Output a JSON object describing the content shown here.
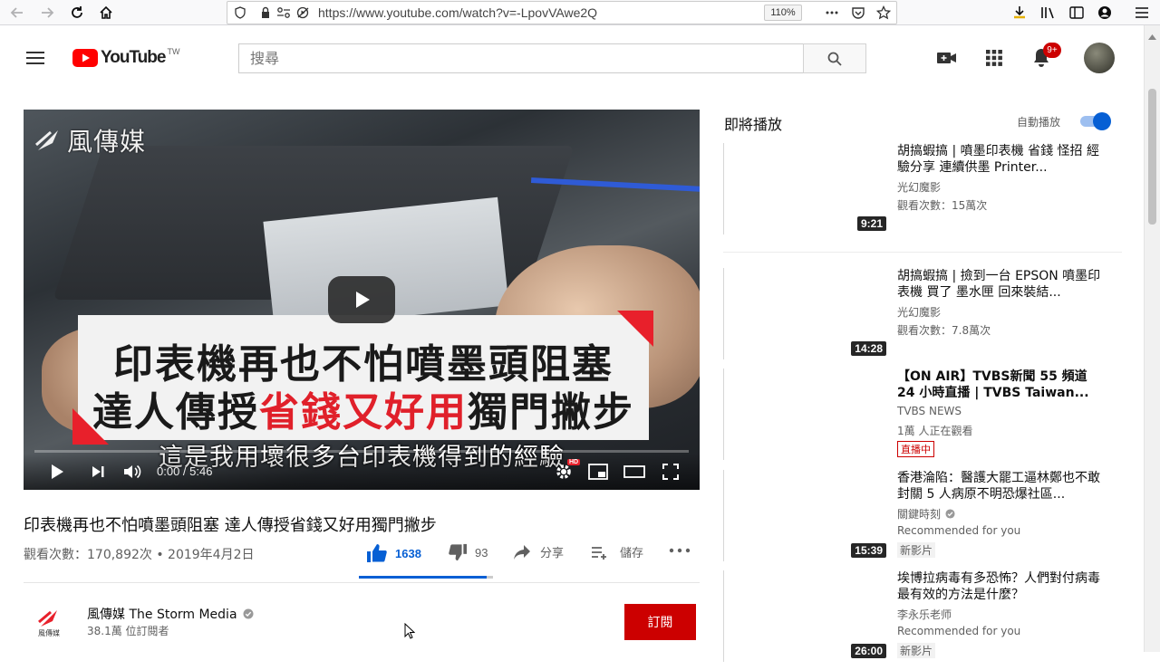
{
  "browser": {
    "url": "https://www.youtube.com/watch?v=-LpovVAwe2Q",
    "zoom": "110%"
  },
  "header": {
    "logo_text": "YouTube",
    "logo_region": "TW",
    "search_placeholder": "搜尋",
    "notification_count": "9+"
  },
  "player": {
    "watermark": "風傳媒",
    "banner_line1": "印表機再也不怕噴墨頭阻塞",
    "banner_line2_a": "達人傳授",
    "banner_line2_b": "省錢又好用",
    "banner_line2_c": "獨門撇步",
    "subtitle": "這是我用壞很多台印表機得到的經驗",
    "time": "0:00 / 5:46",
    "hd_badge": "HD"
  },
  "video": {
    "title": "印表機再也不怕噴墨頭阻塞 達人傳授省錢又好用獨門撇步",
    "views_date": "觀看次數：170,892次 • 2019年4月2日",
    "likes": "1638",
    "dislikes": "93",
    "share_label": "分享",
    "save_label": "儲存",
    "like_ratio": 0.95
  },
  "channel": {
    "logo_text": "風傳媒",
    "name": "風傳媒 The Storm Media",
    "subscribers": "38.1萬 位訂閱者",
    "subscribe_label": "訂閱"
  },
  "sidebar": {
    "up_next": "即將播放",
    "autoplay_label": "自動播放",
    "items": [
      {
        "title": "胡搞蝦搞 | 噴墨印表機 省錢 怪招 經驗分享 連續供墨 Printer...",
        "channel": "光幻魔影",
        "meta": "觀看次數：15萬次",
        "duration": "9:21"
      },
      {
        "title": "胡搞蝦搞 | 撿到一台 EPSON 噴墨印表機 買了 墨水匣 回來裝結...",
        "channel": "光幻魔影",
        "meta": "觀看次數：7.8萬次",
        "duration": "14:28"
      },
      {
        "title": "【ON AIR】TVBS新聞 55 頻道 24 小時直播 | TVBS Taiwan...",
        "channel": "TVBS NEWS",
        "meta": "1萬 人正在觀看",
        "badge": "直播中"
      },
      {
        "title": "香港淪陷：醫護大罷工逼林鄭也不敢封關 5 人病原不明恐爆社區...",
        "channel": "關鍵時刻",
        "meta": "Recommended for you",
        "tag": "新影片",
        "duration": "15:39"
      },
      {
        "title": "埃博拉病毒有多恐怖？人們對付病毒最有效的方法是什麼？",
        "channel": "李永乐老师",
        "meta": "Recommended for you",
        "tag": "新影片",
        "duration": "26:00"
      }
    ]
  }
}
